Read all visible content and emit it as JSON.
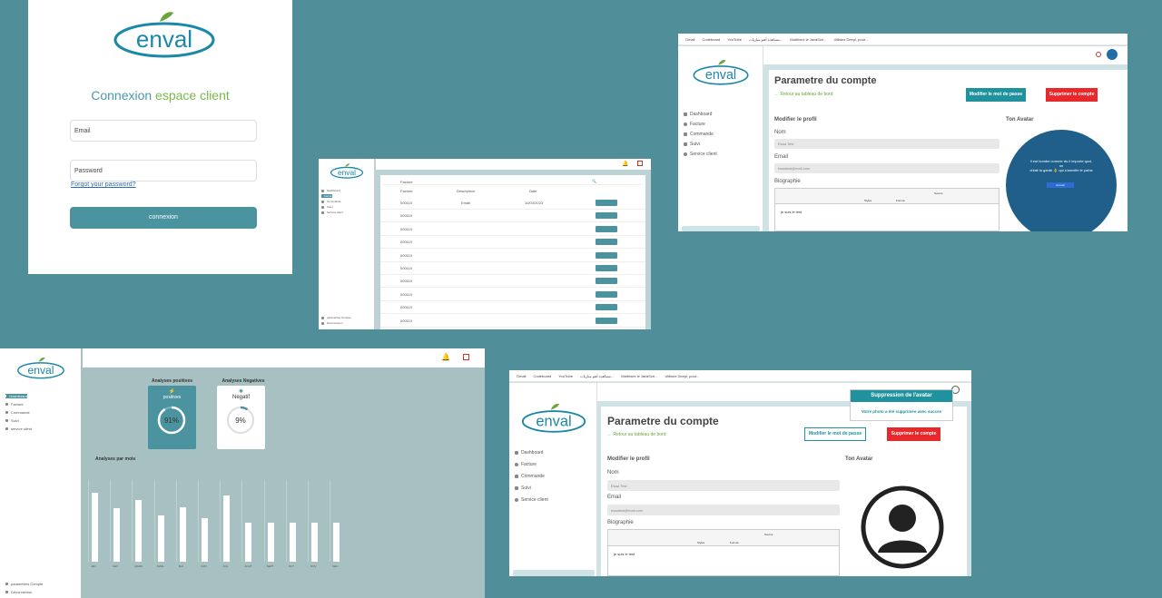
{
  "colors": {
    "teal": "#4a939f",
    "background": "#508f99",
    "red": "#e8282a",
    "brand_green": "#6aa53c",
    "brand_blue": "#1b88a8"
  },
  "brand": {
    "logo_text": "enval"
  },
  "login": {
    "title_part1": "Connexion",
    "title_part2": "espace client",
    "email_placeholder": "Email",
    "password_placeholder": "Password",
    "forgot": "Forgot your password?",
    "submit": "connexion"
  },
  "invoices": {
    "nav": [
      "Dashboard",
      "Facture",
      "Commande",
      "Suivi",
      "Service client"
    ],
    "nav_bottom": [
      "paramètres Compte",
      "Déconnexion"
    ],
    "card_title": "Facture",
    "columns": [
      "Facture",
      "Description",
      "Date"
    ],
    "rows": [
      {
        "id": "000110",
        "desc": "Email",
        "date": "10/03/2023"
      },
      {
        "id": "000110",
        "desc": "",
        "date": ""
      },
      {
        "id": "000110",
        "desc": "",
        "date": ""
      },
      {
        "id": "000110",
        "desc": "",
        "date": ""
      },
      {
        "id": "000110",
        "desc": "",
        "date": ""
      },
      {
        "id": "000110",
        "desc": "",
        "date": ""
      },
      {
        "id": "000110",
        "desc": "",
        "date": ""
      },
      {
        "id": "000110",
        "desc": "",
        "date": ""
      },
      {
        "id": "000110",
        "desc": "",
        "date": ""
      },
      {
        "id": "000110",
        "desc": "",
        "date": ""
      }
    ]
  },
  "browser": {
    "bookmarks": [
      "Gmail",
      "Codeboard",
      "YouTube",
      "مشاهدة أهم مباريات...",
      "Maîtrisez le JavaScri...",
      "Utilisez Deepl, pour..."
    ]
  },
  "account": {
    "title": "Parametre du compte",
    "back": "← Retour au tableau de bord",
    "btn_change_password": "Modifier le mot de passe",
    "btn_delete_account": "Supprimer le compte",
    "section_profile": "Modifier le profil",
    "label_name": "Nom",
    "value_name": "Esaa Test",
    "label_email": "Email",
    "value_email": "esaatest@mail.com",
    "label_bio": "Biographie",
    "bio_text": "je suis le test",
    "toolbar_styles": "Styles",
    "toolbar_format": "Format",
    "toolbar_source": "Source",
    "avatar_title": "Ton Avatar",
    "avatar_caption_line1": "Il est bombe comme du il importe quoi, on",
    "avatar_caption_line2": "chiait la garde 👌 qui s'annelle le pafos",
    "avatar_btn": "Accueil"
  },
  "nav_account": [
    "Dashboard",
    "Facture",
    "Commande",
    "Suivi",
    "Service client"
  ],
  "dashboard": {
    "nav": [
      "Dashboard",
      "Facture",
      "Commande",
      "Suivi",
      "service client"
    ],
    "nav_bottom": [
      "paramètres Compte",
      "Déconnexion"
    ],
    "positive_title": "Analyses positives",
    "positive_label": "positives",
    "positive_value": "91%",
    "negative_title": "Analyses Negatives",
    "negative_label": "Negatif",
    "negative_value": "9%",
    "monthly_title": "Analyses par mois"
  },
  "chart_data": {
    "type": "bar",
    "title": "Analyses par mois",
    "categories": [
      "JAN",
      "FEV",
      "MARS",
      "AVRIL",
      "MAI",
      "JUIN",
      "JUIL",
      "AOUT",
      "SEPT",
      "OCT",
      "NOV",
      "DEC"
    ],
    "values": [
      85,
      66,
      76,
      57,
      67,
      53,
      81,
      48,
      48,
      48,
      48,
      48
    ],
    "ylim": [
      0,
      100
    ]
  },
  "toast": {
    "title": "Suppression de l'avatar",
    "message": "Votre photo a été supprimée avec succes"
  }
}
